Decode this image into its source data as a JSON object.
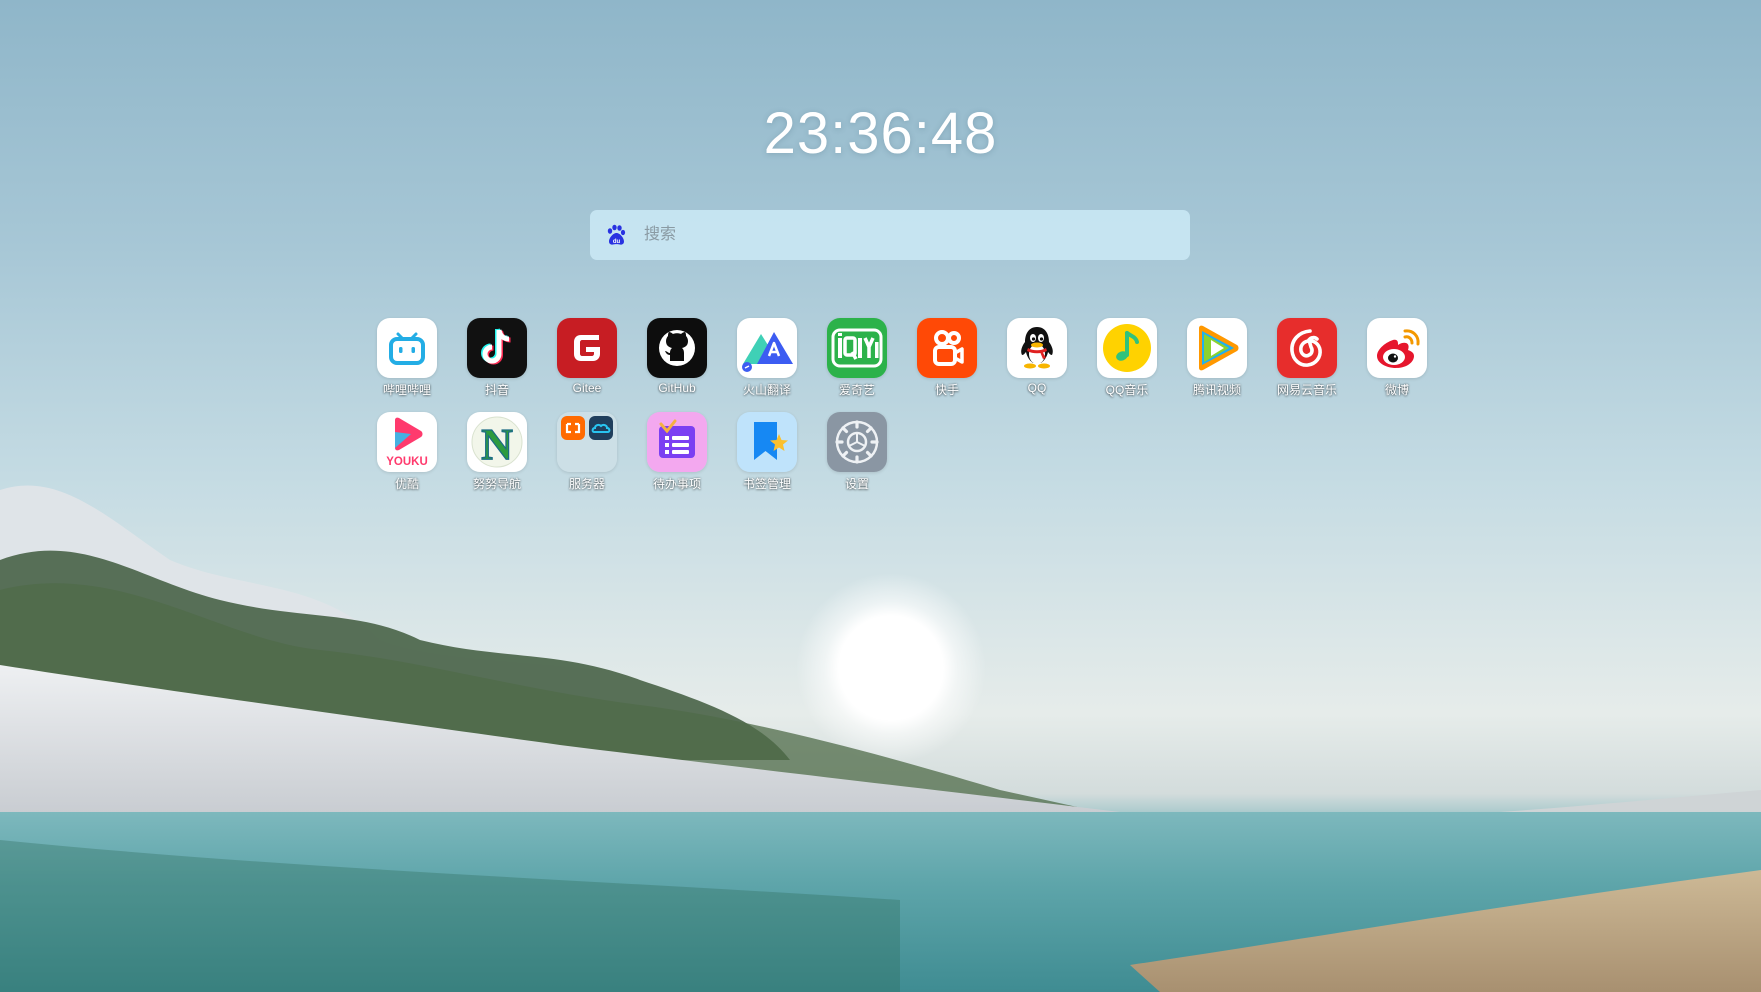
{
  "clock": {
    "time": "23:36:48"
  },
  "search": {
    "placeholder": "搜索",
    "engine_icon": "baidu-paw-icon"
  },
  "apps": {
    "row1": [
      {
        "label": "哔哩哔哩",
        "icon": "bilibili-icon"
      },
      {
        "label": "抖音",
        "icon": "douyin-icon"
      },
      {
        "label": "Gitee",
        "icon": "gitee-icon"
      },
      {
        "label": "GitHub",
        "icon": "github-icon"
      },
      {
        "label": "火山翻译",
        "icon": "volcano-translate-icon"
      },
      {
        "label": "爱奇艺",
        "icon": "iqiyi-icon"
      },
      {
        "label": "快手",
        "icon": "kuaishou-icon"
      },
      {
        "label": "QQ",
        "icon": "qq-penguin-icon"
      },
      {
        "label": "QQ音乐",
        "icon": "qq-music-icon"
      },
      {
        "label": "腾讯视频",
        "icon": "tencent-video-icon"
      },
      {
        "label": "网易云音乐",
        "icon": "netease-music-icon"
      },
      {
        "label": "微博",
        "icon": "weibo-icon"
      }
    ],
    "row2": [
      {
        "label": "优酷",
        "icon": "youku-icon",
        "text": "YOUKU"
      },
      {
        "label": "努努导航",
        "icon": "nunu-nav-icon",
        "text": "N"
      },
      {
        "label": "服务器",
        "icon": "server-folder-icon"
      },
      {
        "label": "待办事项",
        "icon": "todo-list-icon"
      },
      {
        "label": "书签管理",
        "icon": "bookmark-icon"
      },
      {
        "label": "设置",
        "icon": "gear-icon"
      }
    ]
  },
  "colors": {
    "bilibili": "#23ade5",
    "douyin": "#111111",
    "gitee": "#c71d23",
    "github": "#0d0d0d",
    "iqiyi": "#2cb24a",
    "kuaishou": "#ff4906",
    "qqmusic": "#ffd200",
    "netease": "#e72d2c",
    "weibo": "#e6162d",
    "settings": "#8a96a3"
  }
}
